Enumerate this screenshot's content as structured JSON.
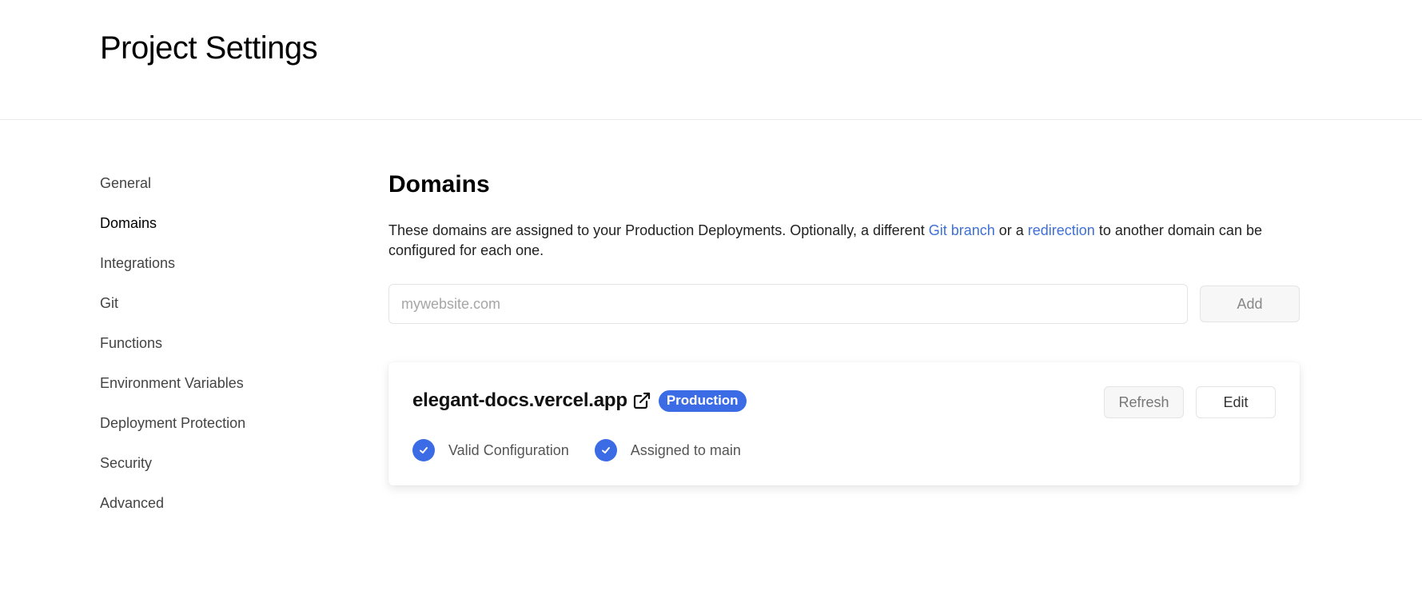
{
  "header": {
    "title": "Project Settings"
  },
  "sidebar": {
    "items": [
      {
        "label": "General"
      },
      {
        "label": "Domains"
      },
      {
        "label": "Integrations"
      },
      {
        "label": "Git"
      },
      {
        "label": "Functions"
      },
      {
        "label": "Environment Variables"
      },
      {
        "label": "Deployment Protection"
      },
      {
        "label": "Security"
      },
      {
        "label": "Advanced"
      }
    ]
  },
  "main": {
    "title": "Domains",
    "description": {
      "part1": "These domains are assigned to your Production Deployments. Optionally, a different ",
      "link1": "Git branch",
      "part2": " or a ",
      "link2": "redirection",
      "part3": " to another domain can be configured for each one."
    },
    "add_form": {
      "placeholder": "mywebsite.com",
      "value": "",
      "add_label": "Add"
    },
    "domain_card": {
      "domain": "elegant-docs.vercel.app",
      "external_icon": "external-link-icon",
      "badge": "Production",
      "refresh_label": "Refresh",
      "edit_label": "Edit",
      "statuses": [
        {
          "label": "Valid Configuration",
          "icon": "check-circle-icon"
        },
        {
          "label": "Assigned to main",
          "icon": "check-circle-icon"
        }
      ]
    }
  },
  "colors": {
    "accent": "#3b6ce6",
    "link": "#3f6fd8",
    "border": "#e4e4e4"
  }
}
